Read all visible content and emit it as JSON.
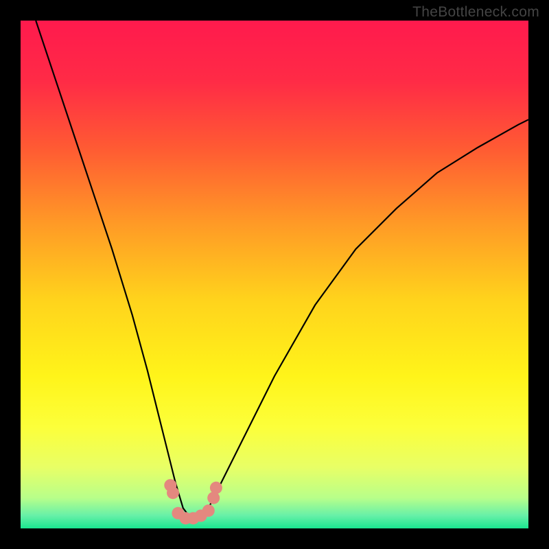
{
  "watermark": "TheBottleneck.com",
  "chart_data": {
    "type": "line",
    "title": "",
    "xlabel": "",
    "ylabel": "",
    "xlim": [
      0,
      100
    ],
    "ylim": [
      0,
      100
    ],
    "background_gradient": [
      {
        "offset": 0.0,
        "color": "#ff1a4d"
      },
      {
        "offset": 0.12,
        "color": "#ff2b46"
      },
      {
        "offset": 0.25,
        "color": "#ff5a33"
      },
      {
        "offset": 0.4,
        "color": "#ff9a26"
      },
      {
        "offset": 0.55,
        "color": "#ffd31c"
      },
      {
        "offset": 0.7,
        "color": "#fff41a"
      },
      {
        "offset": 0.8,
        "color": "#fcff3a"
      },
      {
        "offset": 0.88,
        "color": "#e8ff66"
      },
      {
        "offset": 0.94,
        "color": "#b8ff8a"
      },
      {
        "offset": 0.975,
        "color": "#66f0a8"
      },
      {
        "offset": 1.0,
        "color": "#1ae68f"
      }
    ],
    "curve": {
      "x": [
        3,
        6,
        10,
        14,
        18,
        22,
        25,
        27,
        29,
        30.5,
        32,
        33.5,
        35,
        37,
        40,
        44,
        50,
        58,
        66,
        74,
        82,
        90,
        98,
        100
      ],
      "y": [
        100,
        91,
        79,
        67,
        55,
        42,
        31,
        23,
        15,
        9,
        4,
        2,
        2,
        4,
        10,
        18,
        30,
        44,
        55,
        63,
        70,
        75,
        79.5,
        80.5
      ]
    },
    "markers": {
      "x": [
        29.5,
        30,
        31,
        32.5,
        34,
        35.5,
        37,
        38,
        38.5
      ],
      "y": [
        8.5,
        7,
        3,
        2,
        2,
        2.5,
        3.5,
        6,
        8
      ],
      "color": "#e4887f",
      "radius": 9
    }
  }
}
